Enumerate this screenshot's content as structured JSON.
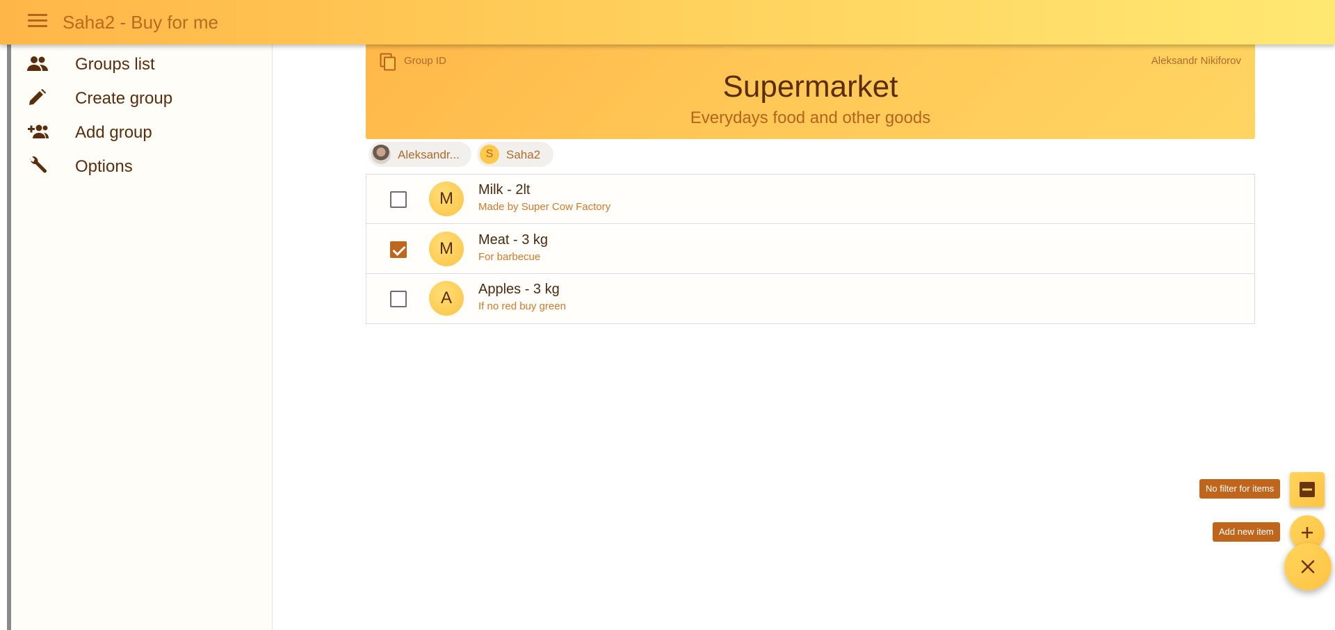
{
  "app": {
    "title": "Saha2 - Buy for me"
  },
  "drawer": {
    "items": [
      {
        "label": "Groups list",
        "icon": "groups-icon"
      },
      {
        "label": "Create group",
        "icon": "pencil-icon"
      },
      {
        "label": "Add group",
        "icon": "add-group-icon"
      },
      {
        "label": "Options",
        "icon": "wrench-icon"
      }
    ]
  },
  "group": {
    "id_label": "Group ID",
    "owner": "Aleksandr Nikiforov",
    "title": "Supermarket",
    "subtitle": "Everydays food and other goods"
  },
  "members": [
    {
      "name": "Aleksandr...",
      "avatar": "photo"
    },
    {
      "name": "Saha2",
      "avatar_letter": "S"
    }
  ],
  "items": [
    {
      "letter": "M",
      "name": "Milk - 2lt",
      "description": "Made by Super Cow Factory",
      "checked": false
    },
    {
      "letter": "M",
      "name": "Meat - 3 kg",
      "description": "For barbecue",
      "checked": true
    },
    {
      "letter": "A",
      "name": "Apples - 3 kg",
      "description": "If no red buy green",
      "checked": false
    }
  ],
  "fab": {
    "filter_tooltip": "No filter for items",
    "add_tooltip": "Add new item",
    "filter_icon": "minus-icon",
    "add_icon": "plus-icon",
    "main_icon": "close-icon"
  },
  "colors": {
    "accent": "#ffc445",
    "brand_dark": "#5a2d0c",
    "brand_orange": "#c0651c"
  }
}
